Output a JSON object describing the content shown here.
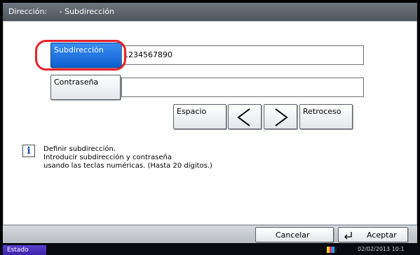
{
  "title_bar": {
    "label": "Dirección:",
    "value": "- Subdirección"
  },
  "form": {
    "subaddress_button": "Subdirección",
    "subaddress_value": "1234567890",
    "password_button": "Contraseña",
    "password_value": ""
  },
  "keypad": {
    "space_label": "Espacio",
    "backspace_label": "Retroceso"
  },
  "info": {
    "line1": "Definir subdirección.",
    "line2": "Introducir subdirección y contraseña",
    "line3": "usando las teclas numéricas. (Hasta 20 dígitos.)"
  },
  "footer": {
    "cancel_label": "Cancelar",
    "accept_label": "Aceptar"
  },
  "status_bar": {
    "status_label": "Estado",
    "datetime": "02/02/2013  10:1",
    "toner_colors": [
      "#f2d21b",
      "#e0258f",
      "#1f9fe0",
      "#222222"
    ]
  },
  "colors": {
    "selected_button": "#1f6fe0",
    "highlight_ring": "#e8202a"
  }
}
